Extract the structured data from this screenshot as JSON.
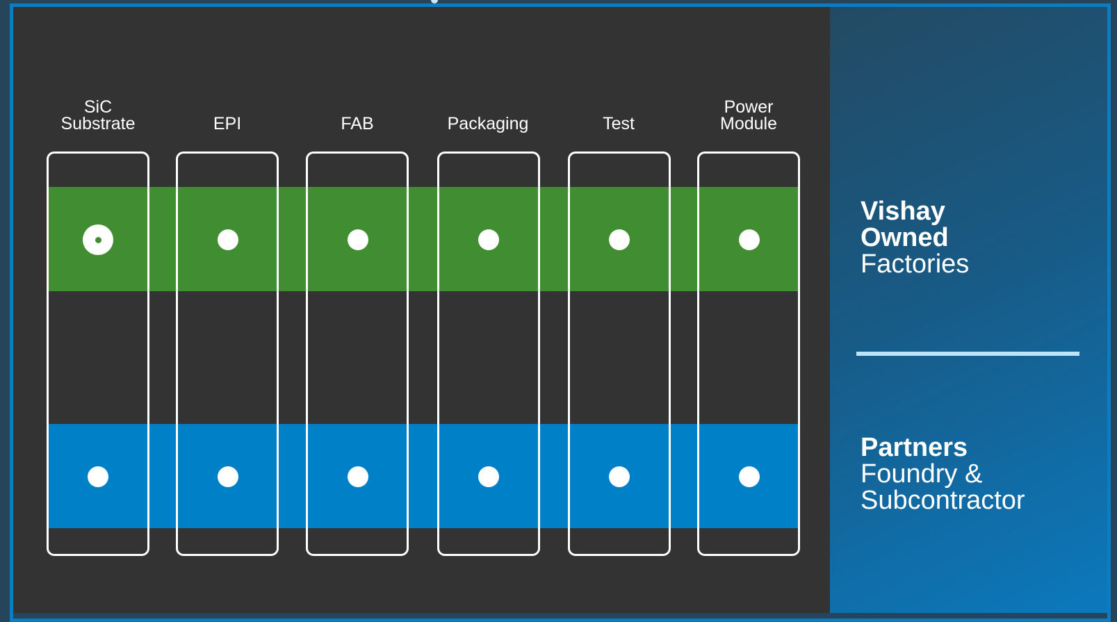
{
  "colors": {
    "owned_band": "#418d31",
    "partners_band": "#0080c7",
    "panel_bg": "#333333",
    "frame": "#0c7dc2",
    "dot": "#ffffff"
  },
  "columns": [
    {
      "label_lines": [
        "SiC",
        "Substrate"
      ]
    },
    {
      "label_lines": [
        "EPI"
      ]
    },
    {
      "label_lines": [
        "FAB"
      ]
    },
    {
      "label_lines": [
        "Packaging"
      ]
    },
    {
      "label_lines": [
        "Test"
      ]
    },
    {
      "label_lines": [
        "Power",
        "Module"
      ]
    }
  ],
  "rows": {
    "owned": {
      "bold_lines": [
        "Vishay",
        "Owned"
      ],
      "normal_lines": [
        "Factories"
      ],
      "highlighted_column": 0
    },
    "partners": {
      "bold_lines": [
        "Partners"
      ],
      "normal_lines": [
        "Foundry &",
        "Subcontractor"
      ]
    }
  }
}
